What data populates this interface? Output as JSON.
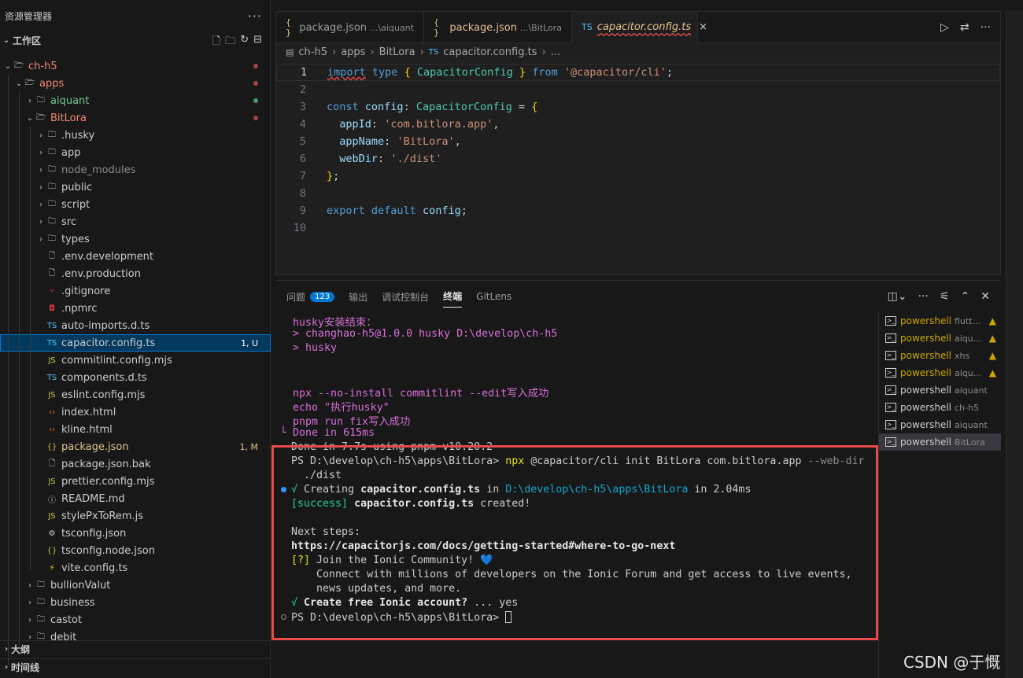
{
  "sidebar": {
    "title": "资源管理器",
    "more": "···",
    "workspace": "工作区",
    "workspace_actions": [
      "new-file-icon",
      "new-folder-icon",
      "refresh-icon",
      "collapse-icon"
    ],
    "tree": [
      {
        "label": "ch-h5",
        "type": "folder",
        "open": true,
        "depth": 0,
        "color": "red",
        "dot": "red"
      },
      {
        "label": "apps",
        "type": "folder",
        "open": true,
        "depth": 1,
        "color": "red",
        "dot": "red"
      },
      {
        "label": "aiquant",
        "type": "folder",
        "open": false,
        "depth": 2,
        "color": "green",
        "dot": "green"
      },
      {
        "label": "BitLora",
        "type": "folder",
        "open": true,
        "depth": 2,
        "color": "red",
        "dot": "red"
      },
      {
        "label": ".husky",
        "type": "folder",
        "open": false,
        "depth": 3
      },
      {
        "label": "app",
        "type": "folder",
        "open": false,
        "depth": 3
      },
      {
        "label": "node_modules",
        "type": "folder",
        "open": false,
        "depth": 3,
        "color": "dim"
      },
      {
        "label": "public",
        "type": "folder",
        "open": false,
        "depth": 3
      },
      {
        "label": "script",
        "type": "folder",
        "open": false,
        "depth": 3
      },
      {
        "label": "src",
        "type": "folder",
        "open": false,
        "depth": 3
      },
      {
        "label": "types",
        "type": "folder",
        "open": false,
        "depth": 3
      },
      {
        "label": ".env.development",
        "type": "file",
        "icon": "file",
        "depth": 3
      },
      {
        "label": ".env.production",
        "type": "file",
        "icon": "file",
        "depth": 3
      },
      {
        "label": ".gitignore",
        "type": "file",
        "icon": "git",
        "depth": 3
      },
      {
        "label": ".npmrc",
        "type": "file",
        "icon": "npm",
        "depth": 3
      },
      {
        "label": "auto-imports.d.ts",
        "type": "file",
        "icon": "TS",
        "depth": 3
      },
      {
        "label": "capacitor.config.ts",
        "type": "file",
        "icon": "TS",
        "depth": 3,
        "selected": true,
        "badge": "1, U"
      },
      {
        "label": "commitlint.config.mjs",
        "type": "file",
        "icon": "JS",
        "depth": 3
      },
      {
        "label": "components.d.ts",
        "type": "file",
        "icon": "TS",
        "depth": 3
      },
      {
        "label": "eslint.config.mjs",
        "type": "file",
        "icon": "JS",
        "depth": 3
      },
      {
        "label": "index.html",
        "type": "file",
        "icon": "<>",
        "depth": 3
      },
      {
        "label": "kline.html",
        "type": "file",
        "icon": "<>",
        "depth": 3
      },
      {
        "label": "package.json",
        "type": "file",
        "icon": "{}",
        "depth": 3,
        "color": "yellow",
        "badge": "1, M"
      },
      {
        "label": "package.json.bak",
        "type": "file",
        "icon": "file",
        "depth": 3
      },
      {
        "label": "prettier.config.mjs",
        "type": "file",
        "icon": "JS",
        "depth": 3
      },
      {
        "label": "README.md",
        "type": "file",
        "icon": "info",
        "depth": 3
      },
      {
        "label": "stylePxToRem.js",
        "type": "file",
        "icon": "JS",
        "depth": 3
      },
      {
        "label": "tsconfig.json",
        "type": "file",
        "icon": "gear",
        "depth": 3
      },
      {
        "label": "tsconfig.node.json",
        "type": "file",
        "icon": "{}",
        "depth": 3
      },
      {
        "label": "vite.config.ts",
        "type": "file",
        "icon": "bolt",
        "depth": 3
      },
      {
        "label": "bullionValut",
        "type": "folder",
        "open": false,
        "depth": 2
      },
      {
        "label": "business",
        "type": "folder",
        "open": false,
        "depth": 2
      },
      {
        "label": "castot",
        "type": "folder",
        "open": false,
        "depth": 2
      },
      {
        "label": "debit",
        "type": "folder",
        "open": false,
        "depth": 2
      }
    ],
    "outline": "大纲",
    "timeline": "时间线"
  },
  "editor": {
    "tabs": [
      {
        "icon": "{ }",
        "name": "package.json",
        "path": "...\\aiquant",
        "active": false
      },
      {
        "icon": "{ }",
        "name": "package.json",
        "path": "...\\BitLora",
        "active": false,
        "yellow": true
      },
      {
        "icon": "TS",
        "name": "capacitor.config.ts",
        "path": "",
        "active": true
      }
    ],
    "close_glyph": "×",
    "breadcrumb": [
      "ch-h5",
      "apps",
      "BitLora",
      "capacitor.config.ts",
      "..."
    ],
    "line_numbers": [
      "1",
      "2",
      "3",
      "4",
      "5",
      "6",
      "7",
      "8",
      "9",
      "10"
    ]
  },
  "panel": {
    "tabs": [
      {
        "label": "问题",
        "badge": "123"
      },
      {
        "label": "输出"
      },
      {
        "label": "调试控制台"
      },
      {
        "label": "终端",
        "active": true
      },
      {
        "label": "GitLens"
      }
    ],
    "terminals": [
      {
        "name": "powershell",
        "sub": "flutt...",
        "warn": true
      },
      {
        "name": "powershell",
        "sub": "aiqu...",
        "warn": true
      },
      {
        "name": "powershell",
        "sub": "xhs",
        "warn": true
      },
      {
        "name": "powershell",
        "sub": "aiqu...",
        "warn": true
      },
      {
        "name": "powershell",
        "sub": "aiquant"
      },
      {
        "name": "powershell",
        "sub": "ch-h5"
      },
      {
        "name": "powershell",
        "sub": "aiquant"
      },
      {
        "name": "powershell",
        "sub": "BitLora",
        "active": true
      }
    ],
    "term": {
      "l1": "husky安装结束：",
      "l2": "> changhao-h5@1.0.0 husky D:\\develop\\ch-h5",
      "l3": "> husky",
      "l4": "npx --no-install commitlint --edit写入成功",
      "l5": "echo \"执行husky\"",
      "l6": "pnpm run fix写入成功",
      "l7a": "└",
      "l7b": " Done in 615ms",
      "l8": "Done in 7.7s using pnpm v10.20.2",
      "l9_prompt": "PS D:\\develop\\ch-h5\\apps\\BitLora> ",
      "l9_cmd": "npx",
      "l9_args": " @capacitor/cli init BitLora com.bitlora.app ",
      "l9_flag": "--web-dir",
      "l10": "  ./dist",
      "l11_check": "√",
      "l11_a": " Creating ",
      "l11_b": "capacitor.config.ts",
      "l11_c": " in ",
      "l11_d": "D:\\develop\\ch-h5\\apps\\BitLora",
      "l11_e": " in 2.04ms",
      "l12_a": "[success]",
      "l12_b": " capacitor.config.ts",
      "l12_c": " created!",
      "l13": "Next steps:",
      "l14": "https://capacitorjs.com/docs/getting-started#where-to-go-next",
      "l15_a": "[?]",
      "l15_b": " Join the Ionic Community! ",
      "l15_heart": "💙",
      "l16": "    Connect with millions of developers on the Ionic Forum and get access to live events,",
      "l17": "    news updates, and more.",
      "l18_a": "√",
      "l18_b": " Create free Ionic account?",
      "l18_c": " ... yes",
      "l19": "PS D:\\develop\\ch-h5\\apps\\BitLora> "
    }
  },
  "watermark": "CSDN @于慨"
}
